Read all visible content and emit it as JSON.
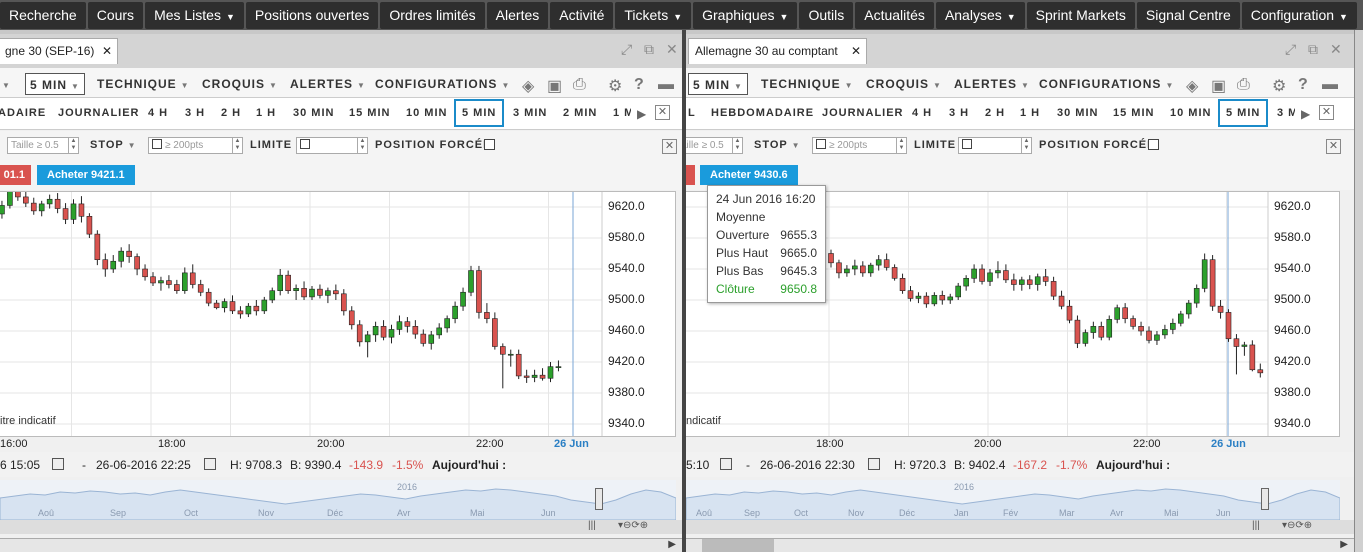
{
  "nav": {
    "items": [
      {
        "label": "Recherche",
        "dd": false
      },
      {
        "label": "Cours",
        "dd": false
      },
      {
        "label": "Mes Listes",
        "dd": true
      },
      {
        "label": "Positions ouvertes",
        "dd": false
      },
      {
        "label": "Ordres limités",
        "dd": false
      },
      {
        "label": "Alertes",
        "dd": false
      },
      {
        "label": "Activité",
        "dd": false
      },
      {
        "label": "Tickets",
        "dd": true
      },
      {
        "label": "Graphiques",
        "dd": true
      },
      {
        "label": "Outils",
        "dd": false
      },
      {
        "label": "Actualités",
        "dd": false
      },
      {
        "label": "Analyses",
        "dd": true
      },
      {
        "label": "Sprint Markets",
        "dd": false
      },
      {
        "label": "Signal Centre",
        "dd": false
      },
      {
        "label": "Configuration",
        "dd": true
      }
    ]
  },
  "toolbar": {
    "interval": "5 MIN",
    "technique": "TECHNIQUE",
    "croquis": "CROQUIS",
    "alertes": "ALERTES",
    "configurations": "CONFIGURATIONS"
  },
  "timeframes_left": [
    "ADAIRE",
    "JOURNALIER",
    "4 H",
    "3 H",
    "2 H",
    "1 H",
    "30 MIN",
    "15 MIN",
    "10 MIN",
    "5 MIN",
    "3 MIN",
    "2 MIN",
    "1 M"
  ],
  "timeframes_right": [
    "L",
    "HEBDOMADAIRE",
    "JOURNALIER",
    "4 H",
    "3 H",
    "2 H",
    "1 H",
    "30 MIN",
    "15 MIN",
    "10 MIN",
    "5 MIN",
    "3 M"
  ],
  "order": {
    "taille_placeholder": "Taille ≥ 0.5",
    "stop": "STOP",
    "stop_placeholder": "≥ 200pts",
    "limite": "LIMITE",
    "position_forcee": "POSITION FORCÉE"
  },
  "left": {
    "tab_title": "gne 30 (SEP-16)",
    "sell": "01.1",
    "buy": "Acheter 9421.1",
    "indicatif": "itre indicatif",
    "yticks": [
      "9620.0",
      "9580.0",
      "9540.0",
      "9500.0",
      "9460.0",
      "9420.0",
      "9380.0",
      "9340.0"
    ],
    "xticks": [
      "16:00",
      "18:00",
      "20:00",
      "22:00"
    ],
    "xdate": "26 Jun",
    "stat_from": "6 15:05",
    "stat_to": "26-06-2016 22:25",
    "stat_h": "H: 9708.3",
    "stat_b": "B: 9390.4",
    "stat_chg": "-143.9",
    "stat_pct": "-1.5%",
    "stat_today": "Aujourd'hui :",
    "nav_months": [
      "Aoû",
      "Sep",
      "Oct",
      "Nov",
      "Déc",
      "Avr",
      "Mai",
      "Jun"
    ],
    "nav_year": "2016"
  },
  "right": {
    "tab_title": "Allemagne 30 au comptant",
    "buy": "Acheter 9430.6",
    "indicatif": "ndicatif",
    "yticks": [
      "9620.0",
      "9580.0",
      "9540.0",
      "9500.0",
      "9460.0",
      "9420.0",
      "9380.0",
      "9340.0"
    ],
    "xticks": [
      "18:00",
      "20:00",
      "22:00"
    ],
    "xdate": "26 Jun",
    "stat_from": "5:10",
    "stat_to": "26-06-2016 22:30",
    "stat_h": "H: 9720.3",
    "stat_b": "B: 9402.4",
    "stat_chg": "-167.2",
    "stat_pct": "-1.7%",
    "stat_today": "Aujourd'hui :",
    "nav_months": [
      "Aoû",
      "Sep",
      "Oct",
      "Nov",
      "Déc",
      "Jan",
      "Fév",
      "Mar",
      "Avr",
      "Mai",
      "Jun"
    ],
    "nav_year": "2016"
  },
  "tooltip": {
    "date": "24 Jun 2016 16:20",
    "type": "Moyenne",
    "open_label": "Ouverture",
    "open": "9655.3",
    "high_label": "Plus Haut",
    "high": "9665.0",
    "low_label": "Plus Bas",
    "low": "9645.3",
    "close_label": "Clôture",
    "close": "9650.8"
  },
  "colors": {
    "up": "#2ca02c",
    "down": "#d9534f",
    "accent": "#1a9bdc"
  },
  "chart_data": [
    {
      "type": "candlestick",
      "ylim": [
        9330,
        9640
      ],
      "yticks": [
        9620,
        9580,
        9540,
        9500,
        9460,
        9420,
        9380,
        9340
      ],
      "xticks": [
        "16:00",
        "18:00",
        "20:00",
        "22:00",
        "26 Jun"
      ],
      "ohlc": [
        [
          9604,
          9617,
          9592,
          9611
        ],
        [
          9611,
          9628,
          9605,
          9622
        ],
        [
          9622,
          9648,
          9618,
          9640
        ],
        [
          9640,
          9650,
          9628,
          9633
        ],
        [
          9633,
          9640,
          9620,
          9625
        ],
        [
          9625,
          9632,
          9610,
          9615
        ],
        [
          9615,
          9628,
          9608,
          9624
        ],
        [
          9624,
          9636,
          9618,
          9630
        ],
        [
          9630,
          9638,
          9612,
          9618
        ],
        [
          9618,
          9625,
          9598,
          9604
        ],
        [
          9604,
          9630,
          9598,
          9624
        ],
        [
          9624,
          9634,
          9600,
          9608
        ],
        [
          9608,
          9612,
          9580,
          9585
        ],
        [
          9585,
          9590,
          9545,
          9552
        ],
        [
          9552,
          9560,
          9530,
          9540
        ],
        [
          9540,
          9558,
          9535,
          9550
        ],
        [
          9550,
          9568,
          9542,
          9563
        ],
        [
          9563,
          9572,
          9548,
          9556
        ],
        [
          9556,
          9560,
          9532,
          9540
        ],
        [
          9540,
          9546,
          9525,
          9530
        ],
        [
          9530,
          9536,
          9518,
          9522
        ],
        [
          9522,
          9530,
          9512,
          9525
        ],
        [
          9525,
          9532,
          9515,
          9520
        ],
        [
          9520,
          9526,
          9508,
          9512
        ],
        [
          9512,
          9542,
          9508,
          9535
        ],
        [
          9535,
          9546,
          9515,
          9520
        ],
        [
          9520,
          9526,
          9505,
          9510
        ],
        [
          9510,
          9515,
          9492,
          9496
        ],
        [
          9496,
          9500,
          9488,
          9490
        ],
        [
          9490,
          9502,
          9484,
          9498
        ],
        [
          9498,
          9506,
          9482,
          9486
        ],
        [
          9486,
          9492,
          9476,
          9482
        ],
        [
          9482,
          9496,
          9478,
          9492
        ],
        [
          9492,
          9500,
          9480,
          9486
        ],
        [
          9486,
          9504,
          9482,
          9500
        ],
        [
          9500,
          9516,
          9496,
          9512
        ],
        [
          9512,
          9540,
          9506,
          9532
        ],
        [
          9532,
          9538,
          9508,
          9512
        ],
        [
          9512,
          9520,
          9500,
          9515
        ],
        [
          9515,
          9524,
          9500,
          9504
        ],
        [
          9504,
          9518,
          9500,
          9514
        ],
        [
          9514,
          9520,
          9502,
          9506
        ],
        [
          9506,
          9516,
          9496,
          9512
        ],
        [
          9512,
          9520,
          9500,
          9508
        ],
        [
          9508,
          9514,
          9480,
          9486
        ],
        [
          9486,
          9492,
          9462,
          9468
        ],
        [
          9468,
          9474,
          9440,
          9446
        ],
        [
          9446,
          9460,
          9426,
          9455
        ],
        [
          9455,
          9472,
          9446,
          9466
        ],
        [
          9466,
          9474,
          9448,
          9452
        ],
        [
          9452,
          9468,
          9444,
          9462
        ],
        [
          9462,
          9480,
          9455,
          9472
        ],
        [
          9472,
          9478,
          9458,
          9466
        ],
        [
          9466,
          9474,
          9450,
          9456
        ],
        [
          9456,
          9462,
          9440,
          9444
        ],
        [
          9444,
          9460,
          9436,
          9455
        ],
        [
          9455,
          9470,
          9450,
          9464
        ],
        [
          9464,
          9480,
          9458,
          9476
        ],
        [
          9476,
          9498,
          9470,
          9492
        ],
        [
          9492,
          9516,
          9486,
          9510
        ],
        [
          9510,
          9544,
          9505,
          9538
        ],
        [
          9538,
          9544,
          9476,
          9484
        ],
        [
          9484,
          9496,
          9470,
          9476
        ],
        [
          9476,
          9484,
          9436,
          9440
        ],
        [
          9440,
          9444,
          9386,
          9430
        ],
        [
          9430,
          9436,
          9414,
          9430
        ],
        [
          9430,
          9436,
          9398,
          9402
        ],
        [
          9402,
          9410,
          9393,
          9400
        ],
        [
          9400,
          9410,
          9394,
          9403
        ],
        [
          9403,
          9412,
          9396,
          9399
        ],
        [
          9399,
          9420,
          9394,
          9414
        ],
        [
          9414,
          9422,
          9408,
          9414
        ]
      ]
    },
    {
      "type": "candlestick",
      "ylim": [
        9330,
        9640
      ],
      "yticks": [
        9620,
        9580,
        9540,
        9500,
        9460,
        9420,
        9380,
        9340
      ],
      "xticks": [
        "18:00",
        "20:00",
        "22:00",
        "26 Jun"
      ],
      "ohlc": [
        [
          9560,
          9565,
          9542,
          9548
        ],
        [
          9548,
          9552,
          9528,
          9535
        ],
        [
          9535,
          9545,
          9530,
          9540
        ],
        [
          9540,
          9552,
          9532,
          9544
        ],
        [
          9544,
          9550,
          9530,
          9535
        ],
        [
          9535,
          9548,
          9530,
          9545
        ],
        [
          9545,
          9558,
          9538,
          9552
        ],
        [
          9552,
          9560,
          9538,
          9542
        ],
        [
          9542,
          9546,
          9525,
          9528
        ],
        [
          9528,
          9534,
          9508,
          9512
        ],
        [
          9512,
          9518,
          9498,
          9502
        ],
        [
          9502,
          9510,
          9496,
          9505
        ],
        [
          9505,
          9510,
          9490,
          9495
        ],
        [
          9495,
          9510,
          9492,
          9506
        ],
        [
          9506,
          9512,
          9494,
          9500
        ],
        [
          9500,
          9508,
          9495,
          9504
        ],
        [
          9504,
          9522,
          9500,
          9518
        ],
        [
          9518,
          9532,
          9512,
          9528
        ],
        [
          9528,
          9546,
          9522,
          9540
        ],
        [
          9540,
          9546,
          9520,
          9524
        ],
        [
          9524,
          9540,
          9518,
          9535
        ],
        [
          9535,
          9550,
          9528,
          9538
        ],
        [
          9538,
          9546,
          9522,
          9526
        ],
        [
          9526,
          9534,
          9512,
          9520
        ],
        [
          9520,
          9530,
          9512,
          9526
        ],
        [
          9526,
          9532,
          9514,
          9520
        ],
        [
          9520,
          9534,
          9512,
          9530
        ],
        [
          9530,
          9540,
          9518,
          9524
        ],
        [
          9524,
          9530,
          9500,
          9505
        ],
        [
          9505,
          9512,
          9488,
          9492
        ],
        [
          9492,
          9500,
          9470,
          9474
        ],
        [
          9474,
          9480,
          9438,
          9444
        ],
        [
          9444,
          9462,
          9440,
          9458
        ],
        [
          9458,
          9472,
          9450,
          9466
        ],
        [
          9466,
          9472,
          9448,
          9452
        ],
        [
          9452,
          9480,
          9448,
          9475
        ],
        [
          9475,
          9494,
          9470,
          9490
        ],
        [
          9490,
          9496,
          9470,
          9476
        ],
        [
          9476,
          9480,
          9462,
          9466
        ],
        [
          9466,
          9472,
          9454,
          9460
        ],
        [
          9460,
          9466,
          9444,
          9448
        ],
        [
          9448,
          9460,
          9442,
          9455
        ],
        [
          9455,
          9468,
          9450,
          9462
        ],
        [
          9462,
          9476,
          9456,
          9470
        ],
        [
          9470,
          9486,
          9466,
          9482
        ],
        [
          9482,
          9500,
          9476,
          9496
        ],
        [
          9496,
          9520,
          9490,
          9515
        ],
        [
          9515,
          9560,
          9510,
          9552
        ],
        [
          9552,
          9558,
          9486,
          9492
        ],
        [
          9492,
          9500,
          9476,
          9484
        ],
        [
          9484,
          9488,
          9446,
          9450
        ],
        [
          9450,
          9456,
          9404,
          9440
        ],
        [
          9440,
          9446,
          9428,
          9442
        ],
        [
          9442,
          9448,
          9408,
          9410
        ],
        [
          9410,
          9418,
          9400,
          9406
        ],
        [
          9406,
          9414,
          9398,
          9410
        ],
        [
          9410,
          9422,
          9404,
          9418
        ],
        [
          9418,
          9428,
          9412,
          9424
        ]
      ]
    }
  ]
}
